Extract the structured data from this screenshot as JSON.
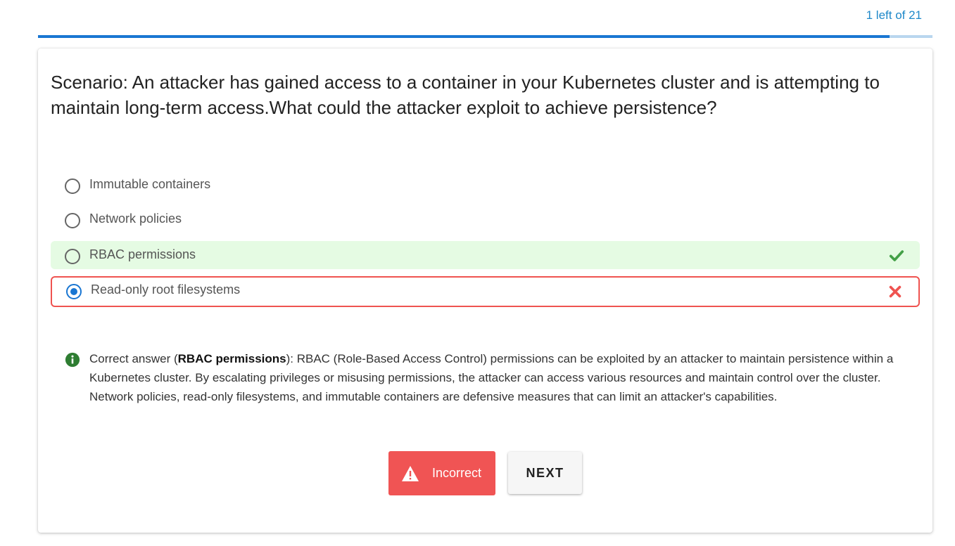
{
  "progress": {
    "text": "1 left of 21",
    "fraction": 0.952
  },
  "question": {
    "text": "Scenario: An attacker has gained access to a container in your Kubernetes cluster and is attempting to maintain long-term access.What could the attacker exploit to achieve persistence?"
  },
  "options": [
    {
      "label": "Immutable containers",
      "state": "none",
      "selected": false
    },
    {
      "label": "Network policies",
      "state": "none",
      "selected": false
    },
    {
      "label": "RBAC permissions",
      "state": "correct",
      "selected": false,
      "icon": "check-icon"
    },
    {
      "label": "Read-only root filesystems",
      "state": "wrong",
      "selected": true,
      "icon": "x-icon"
    }
  ],
  "explanation": {
    "prefix": "Correct answer (",
    "answer": "RBAC permissions",
    "body": "): RBAC (Role-Based Access Control) permissions can be exploited by an attacker to maintain persistence within a Kubernetes cluster. By escalating privileges or misusing permissions, the attacker can access various resources and maintain control over the cluster. Network policies, read-only filesystems, and immutable containers are defensive measures that can limit an attacker's capabilities."
  },
  "buttons": {
    "result_label": "Incorrect",
    "next_label": "NEXT"
  },
  "colors": {
    "accent": "#1976d2",
    "correct_bg": "#e5fbe3",
    "wrong": "#ef5350",
    "check": "#43a047",
    "info": "#2e7d32"
  }
}
